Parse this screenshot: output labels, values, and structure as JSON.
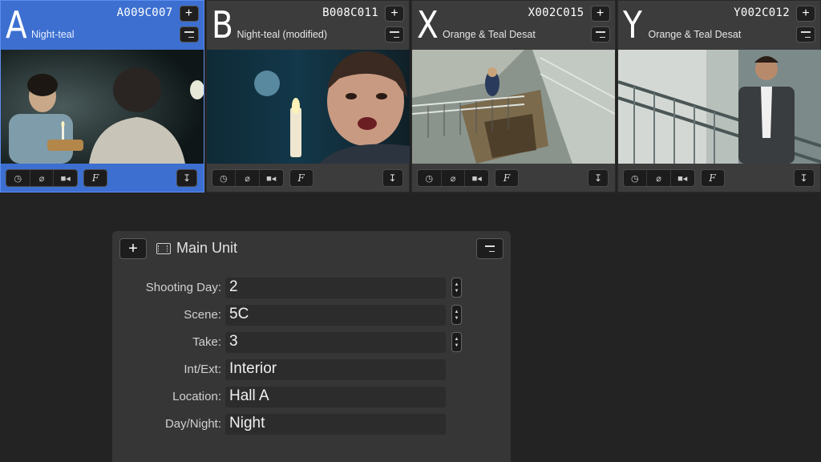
{
  "cameras": [
    {
      "letter": "A",
      "clip": "A009C007",
      "lut": "Night-teal",
      "active": true
    },
    {
      "letter": "B",
      "clip": "B008C011",
      "lut": "Night-teal (modified)",
      "active": false
    },
    {
      "letter": "X",
      "clip": "X002C015",
      "lut": "Orange & Teal Desat",
      "active": false
    },
    {
      "letter": "Y",
      "clip": "Y002C012",
      "lut": "Orange & Teal Desat",
      "active": false
    }
  ],
  "icons": {
    "add": "plus-icon",
    "menu": "list-menu-icon",
    "clock": "clock-icon",
    "no_entry": "circle-slash-icon",
    "camera": "video-camera-icon",
    "f": "F",
    "down": "↧"
  },
  "panel": {
    "title": "Main Unit",
    "fields": [
      {
        "label": "Shooting Day:",
        "value": "2",
        "stepper": true
      },
      {
        "label": "Scene:",
        "value": "5C",
        "stepper": true
      },
      {
        "label": "Take:",
        "value": "3",
        "stepper": true
      },
      {
        "label": "Int/Ext:",
        "value": "Interior",
        "stepper": false
      },
      {
        "label": "Location:",
        "value": "Hall A",
        "stepper": false
      },
      {
        "label": "Day/Night:",
        "value": "Night",
        "stepper": false
      }
    ]
  },
  "colors": {
    "active": "#3c6fd0",
    "background": "#232323",
    "panel": "#363636"
  }
}
